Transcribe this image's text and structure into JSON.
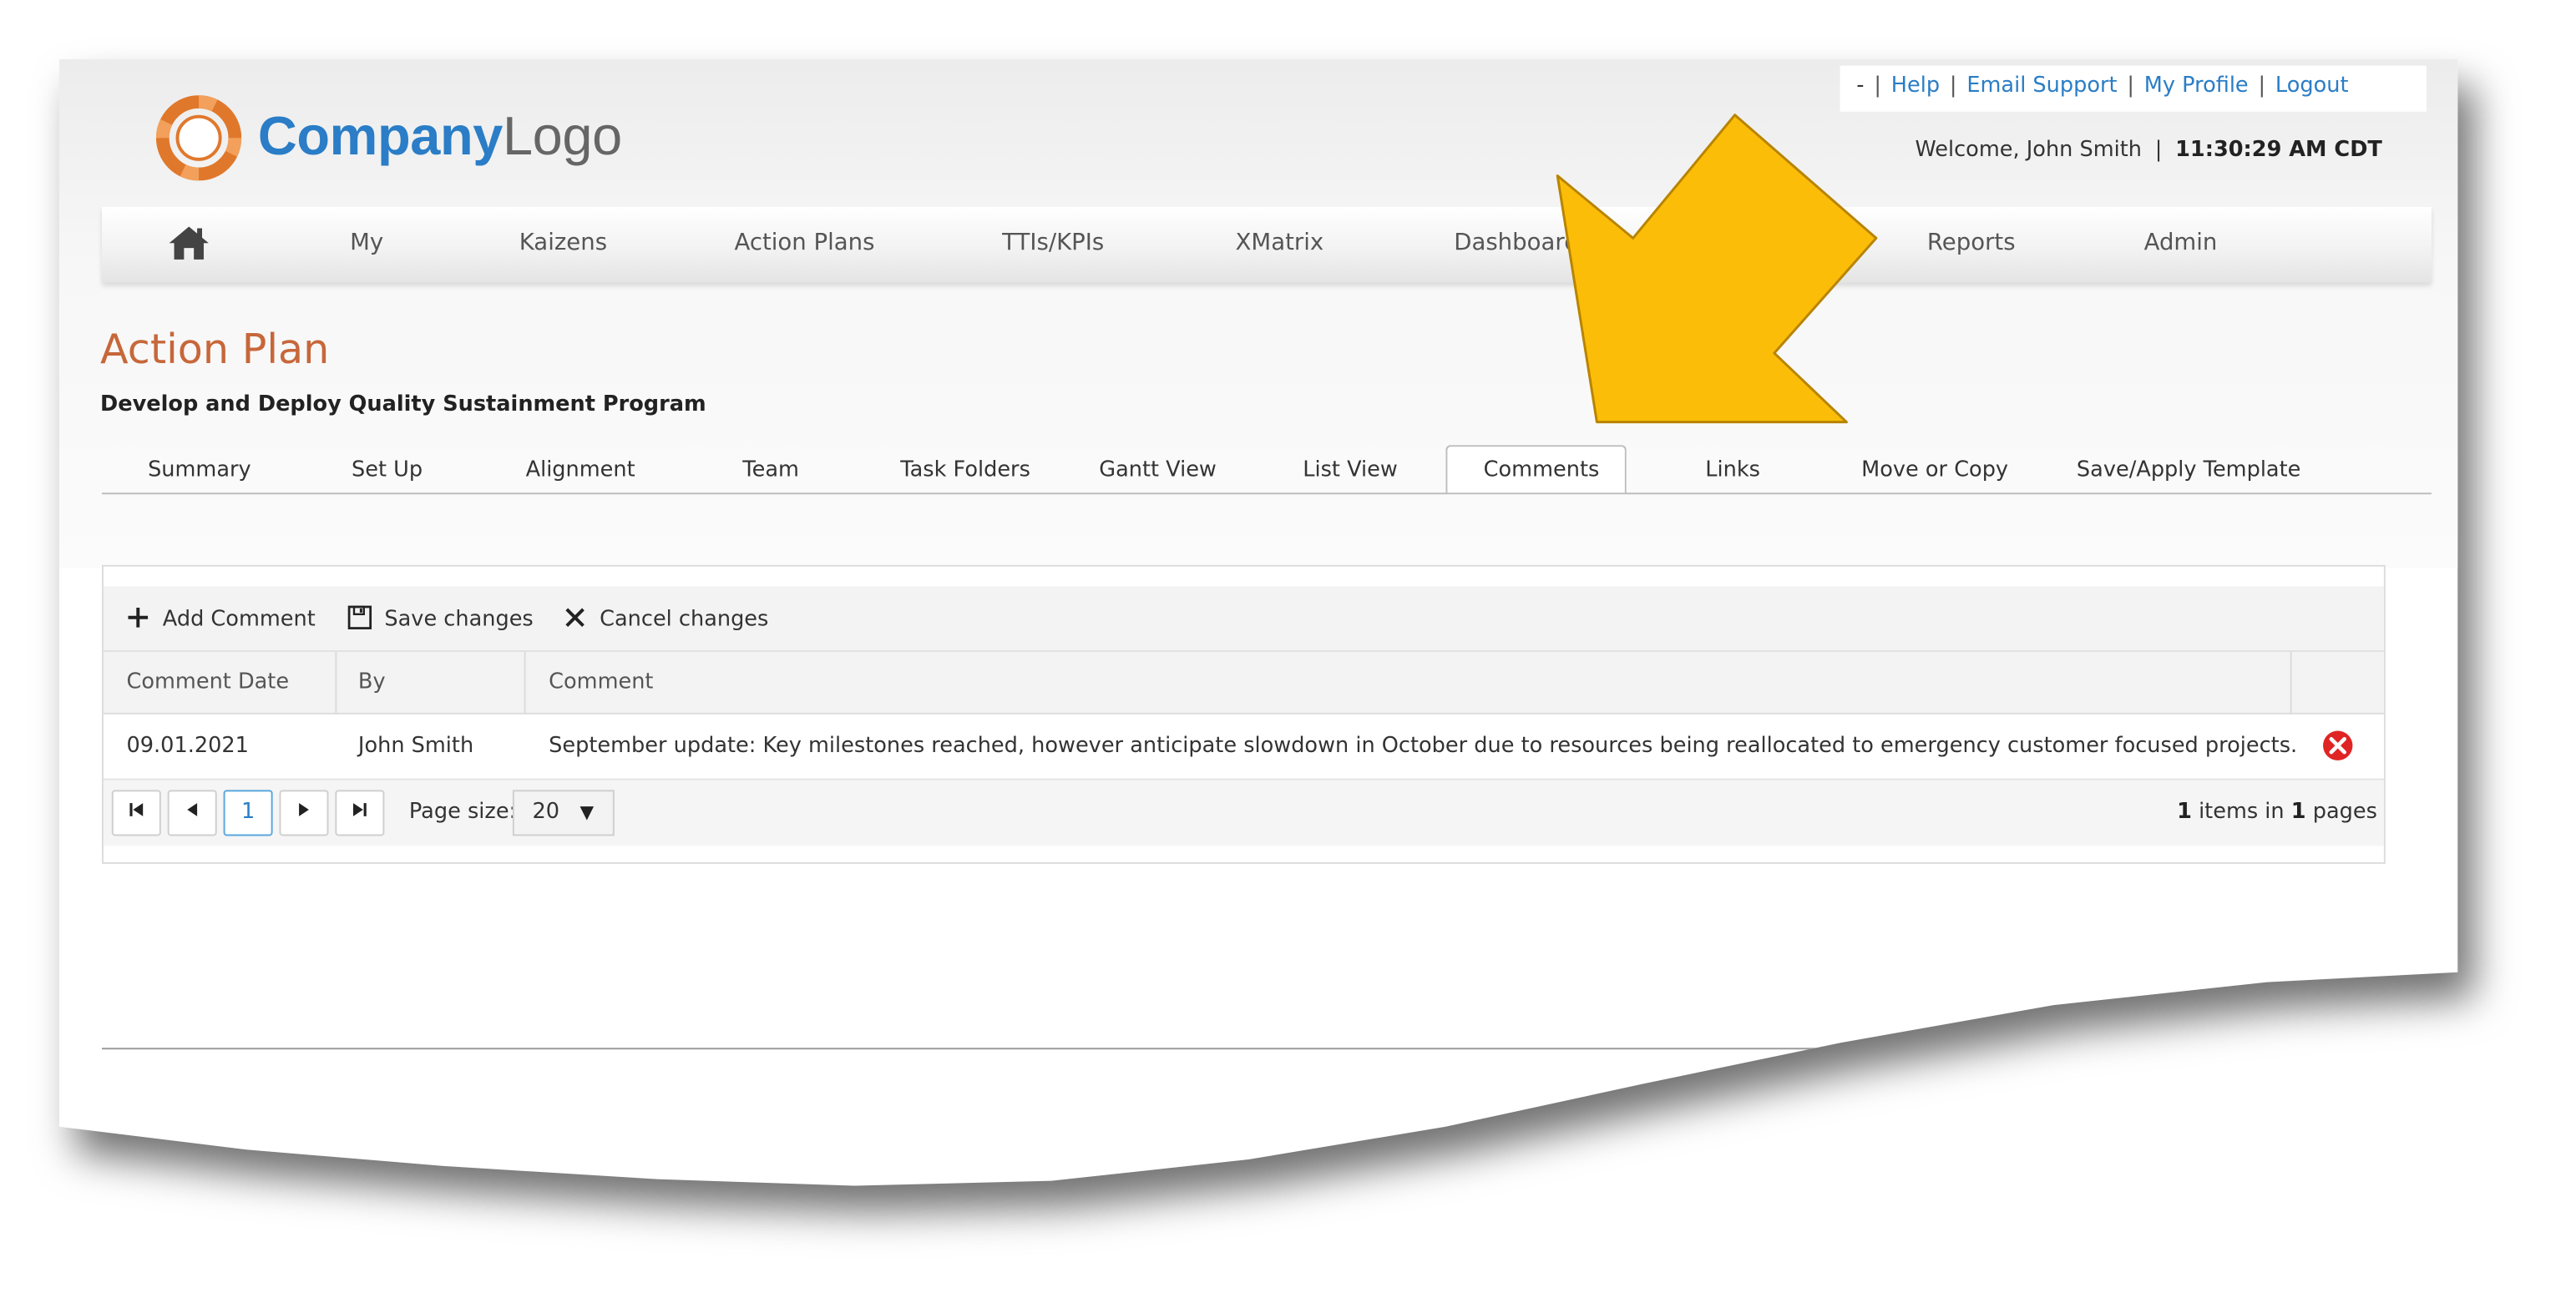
{
  "header": {
    "logo": {
      "brand": "Company",
      "suffix": "Logo"
    },
    "top_links": {
      "dash": "-",
      "help": "Help",
      "email_support": "Email Support",
      "my_profile": "My Profile",
      "logout": "Logout"
    },
    "welcome": "Welcome, John Smith",
    "separator": "|",
    "time": "11:30:29 AM CDT"
  },
  "nav": {
    "home_icon": "home-icon",
    "items": [
      {
        "label": "My"
      },
      {
        "label": "Kaizens"
      },
      {
        "label": "Action Plans"
      },
      {
        "label": "TTIs/KPIs"
      },
      {
        "label": "XMatrix"
      },
      {
        "label": "Dashboard"
      },
      {
        "label": "Reports"
      },
      {
        "label": "Admin"
      }
    ]
  },
  "page": {
    "title": "Action Plan",
    "subtitle": "Develop and Deploy Quality Sustainment Program"
  },
  "tabs": {
    "items": [
      {
        "label": "Summary"
      },
      {
        "label": "Set Up"
      },
      {
        "label": "Alignment"
      },
      {
        "label": "Team"
      },
      {
        "label": "Task Folders"
      },
      {
        "label": "Gantt View"
      },
      {
        "label": "List View"
      },
      {
        "label": "Comments"
      },
      {
        "label": "Links"
      },
      {
        "label": "Move or Copy"
      },
      {
        "label": "Save/Apply Template"
      }
    ],
    "active": "Comments"
  },
  "grid": {
    "toolbar": {
      "add": "Add Comment",
      "save": "Save changes",
      "cancel": "Cancel changes"
    },
    "columns": [
      "Comment Date",
      "By",
      "Comment"
    ],
    "rows": [
      {
        "date": "09.01.2021",
        "by": "John Smith",
        "comment": "September update: Key milestones reached, however anticipate slowdown in October due to resources being reallocated to emergency customer focused projects."
      }
    ],
    "pager": {
      "current_page": "1",
      "page_size_label": "Page size:",
      "page_size": "20",
      "info_count": "1",
      "info_items": "items in",
      "info_pages_count": "1",
      "info_pages": "pages"
    }
  },
  "annotation": {
    "arrow_color": "#fbbd08"
  },
  "colors": {
    "accent": "#2a7dc6",
    "title": "#c7673a",
    "delete": "#e02424"
  }
}
